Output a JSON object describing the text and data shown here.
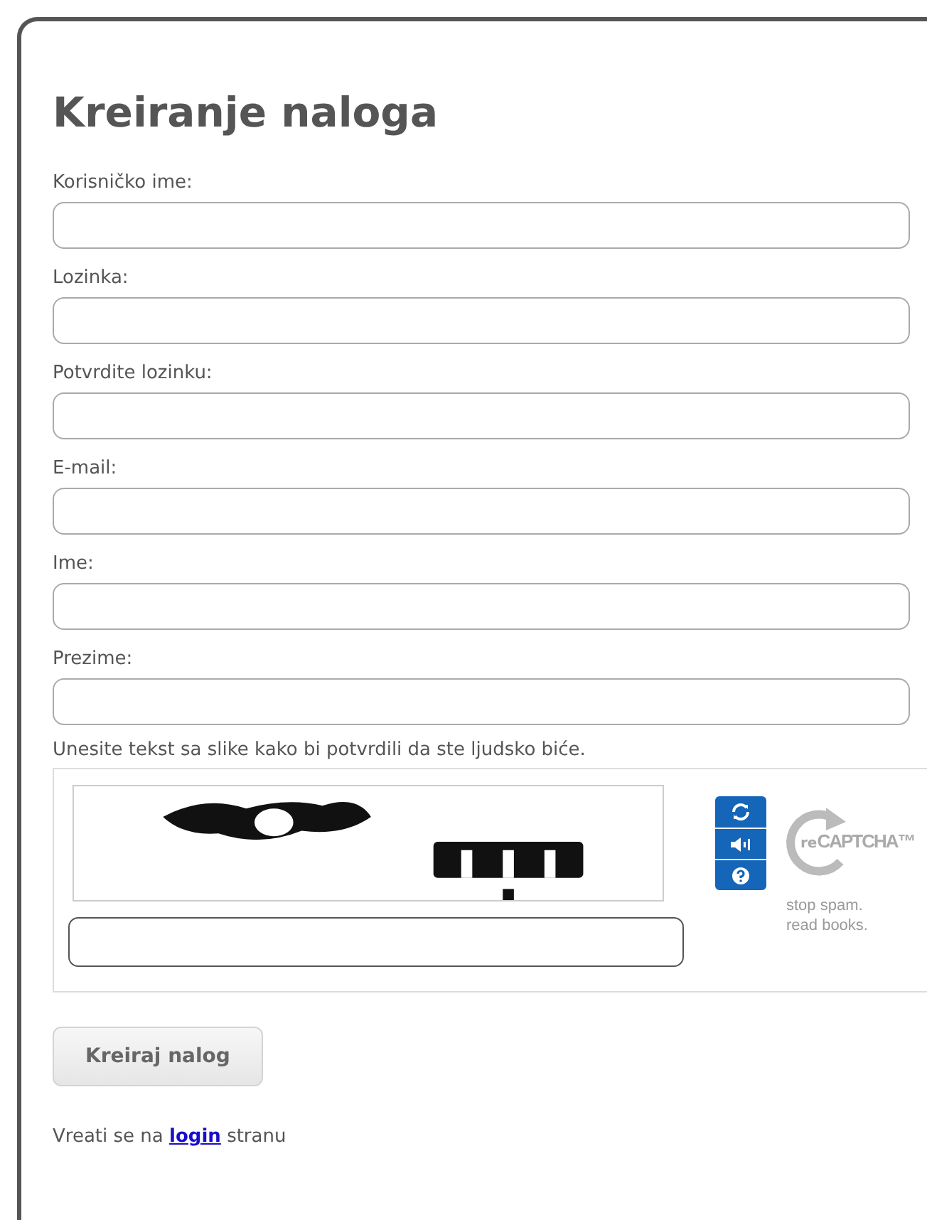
{
  "title": "Kreiranje naloga",
  "fields": [
    {
      "label": "Korisničko ime:"
    },
    {
      "label": "Lozinka:"
    },
    {
      "label": "Potvrdite lozinku:"
    },
    {
      "label": "E-mail:"
    },
    {
      "label": "Ime:"
    },
    {
      "label": "Prezime:"
    }
  ],
  "captcha": {
    "instruction": "Unesite tekst sa slike kako bi potvrdili da ste ljudsko biće.",
    "logo_prefix": "re",
    "logo_text": "CAPTCHA™",
    "tagline_1": "stop spam.",
    "tagline_2": "read books."
  },
  "submit_button": "Kreiraj nalog",
  "footer": {
    "before": "Vreati se na",
    "link": "login",
    "after": "stranu"
  }
}
